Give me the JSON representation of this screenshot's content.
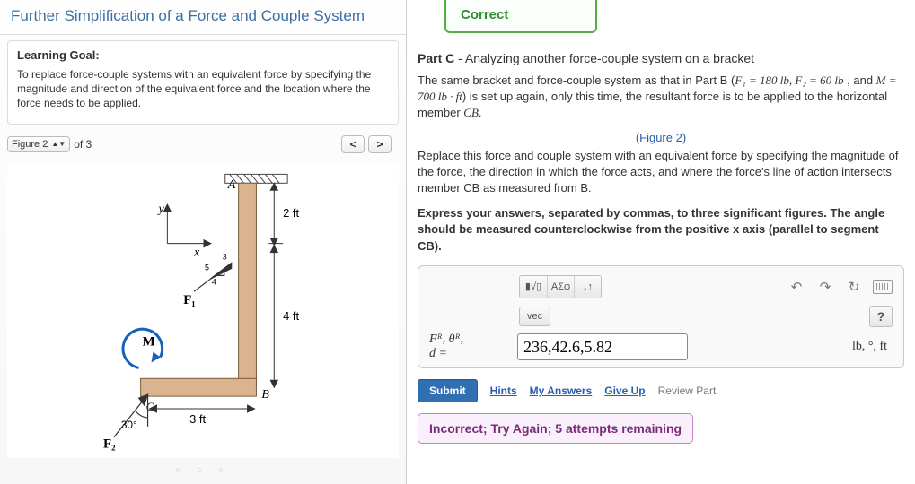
{
  "left": {
    "title": "Further Simplification of a Force and Couple System",
    "goal_heading": "Learning Goal:",
    "goal_text": "To replace force-couple systems with an equivalent force by specifying the magnitude and direction of the equivalent force and the location where the force needs to be applied.",
    "figure_label": "Figure 2",
    "of_label": "of 3",
    "prev_glyph": "<",
    "next_glyph": ">",
    "fig": {
      "y": "y",
      "x": "x",
      "A": "A",
      "B": "B",
      "C": "C",
      "M": "M",
      "F1": "F₁",
      "F2": "F₂",
      "d2ft": "2 ft",
      "d4ft": "4 ft",
      "d3ft": "3 ft",
      "ang30": "30°",
      "t3": "3",
      "t4": "4",
      "t5": "5"
    },
    "dots": "○ ○ ○"
  },
  "right": {
    "correct": "Correct",
    "part_label": "Part C",
    "part_title": " - Analyzing another force-couple system on a bracket",
    "desc1a": "The same bracket and force-couple system as that in Part B (",
    "desc1b": "F₁ = 180 lb, F₂ = 60 lb",
    "desc1c": " , and ",
    "desc1d": "M = 700 lb · ft",
    "desc1e": ") is set up again, only this time, the resultant force is to be applied to the horizontal member ",
    "desc1f": "CB",
    "desc1g": ".",
    "figlink": "(Figure 2)",
    "desc2": "Replace this force and couple system with an equivalent force by specifying the magnitude of the force, the direction in which the force acts, and where the force's line of action intersects member CB as measured from B.",
    "desc3": "Express your answers, separated by commas, to three significant figures. The angle should be measured counterclockwise from the positive x axis (parallel to segment CB).",
    "toolbar": {
      "templates_glyph": "▮√▯",
      "greek_glyph": "ΑΣφ",
      "subsup_glyph": "↓↑",
      "undo_glyph": "↶",
      "redo_glyph": "↷",
      "reset_glyph": "↻",
      "vec_label": "vec",
      "help_glyph": "?"
    },
    "lhs1": "Fᴿ, θᴿ,",
    "lhs2": "d =",
    "input_value": "236,42.6,5.82",
    "units": "lb, °, ft",
    "submit": "Submit",
    "hints": "Hints",
    "myanswers": "My Answers",
    "giveup": "Give Up",
    "review": "Review Part",
    "feedback": "Incorrect; Try Again; 5 attempts remaining"
  }
}
